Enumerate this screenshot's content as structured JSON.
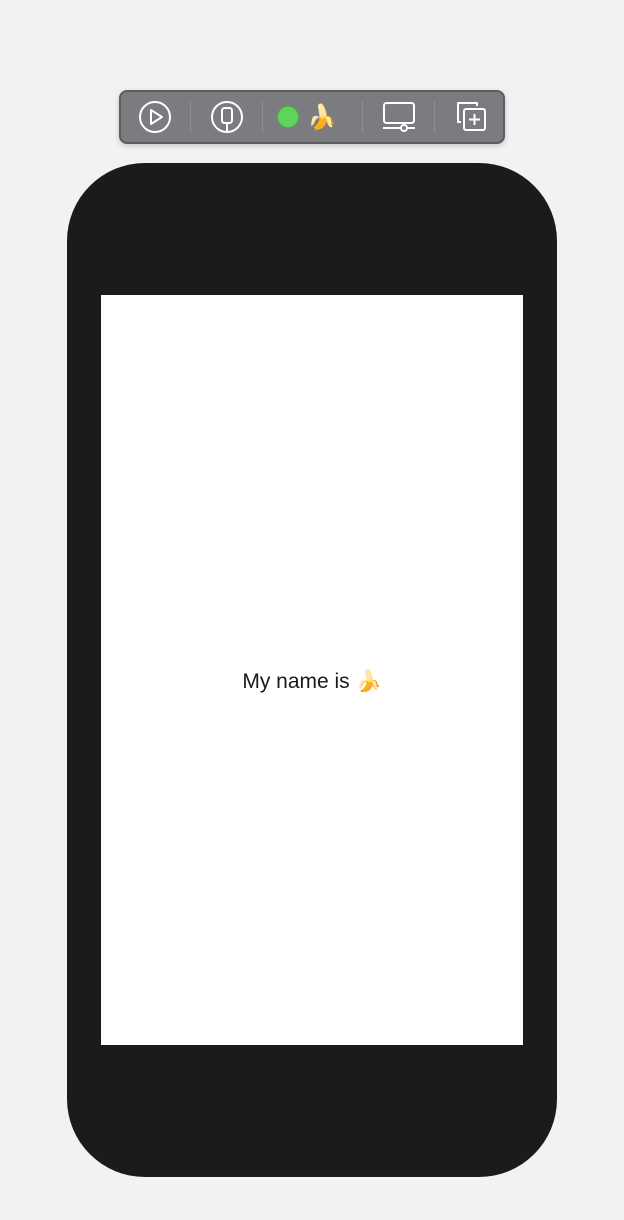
{
  "toolbar": {
    "buttons": [
      {
        "name": "live-preview-button",
        "icon": "play-circle-icon"
      },
      {
        "name": "selectable-mode-button",
        "icon": "device-circle-icon"
      },
      {
        "name": "device-settings-button",
        "icon": "display-settings-icon"
      },
      {
        "name": "duplicate-preview-button",
        "icon": "duplicate-plus-icon"
      }
    ],
    "status": {
      "indicator_color": "#5fd35a",
      "label": "🍌"
    }
  },
  "preview": {
    "text": "My name is 🍌"
  },
  "colors": {
    "background": "#f2f2f2",
    "device_frame": "#1b1b1b",
    "screen": "#ffffff",
    "toolbar": "#7a7c80"
  }
}
